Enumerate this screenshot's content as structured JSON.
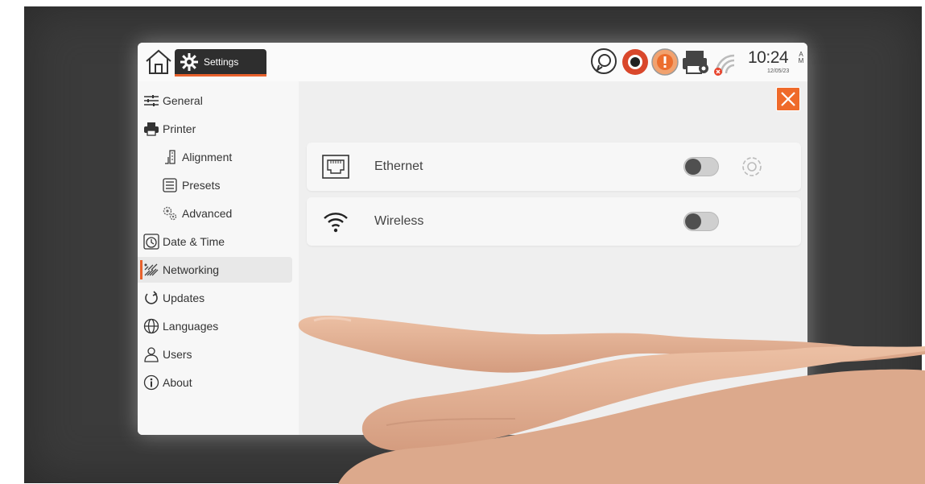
{
  "header": {
    "tab_label": "Settings",
    "clock": {
      "time": "10:24",
      "ampm_top": "A",
      "ampm_bottom": "M",
      "date": "12/05/23"
    }
  },
  "sidebar": {
    "items": [
      {
        "label": "General",
        "icon": "sliders-icon",
        "level": "top"
      },
      {
        "label": "Printer",
        "icon": "printer-icon",
        "level": "top"
      },
      {
        "label": "Alignment",
        "icon": "alignment-icon",
        "level": "sub"
      },
      {
        "label": "Presets",
        "icon": "presets-icon",
        "level": "sub"
      },
      {
        "label": "Advanced",
        "icon": "gears-icon",
        "level": "sub"
      },
      {
        "label": "Date & Time",
        "icon": "clock-icon",
        "level": "top"
      },
      {
        "label": "Networking",
        "icon": "network-icon",
        "level": "top",
        "active": true
      },
      {
        "label": "Updates",
        "icon": "refresh-icon",
        "level": "top"
      },
      {
        "label": "Languages",
        "icon": "globe-icon",
        "level": "top"
      },
      {
        "label": "Users",
        "icon": "user-icon",
        "level": "top"
      },
      {
        "label": "About",
        "icon": "info-icon",
        "level": "top"
      }
    ]
  },
  "networking": {
    "rows": [
      {
        "label": "Ethernet",
        "icon": "ethernet-port-icon",
        "enabled": false
      },
      {
        "label": "Wireless",
        "icon": "wifi-icon",
        "enabled": false
      }
    ]
  },
  "colors": {
    "accent": "#e8612c",
    "close_button": "#ef6a2a",
    "tab_background": "#2e2e2e",
    "bezel": "#3b3b3b"
  }
}
